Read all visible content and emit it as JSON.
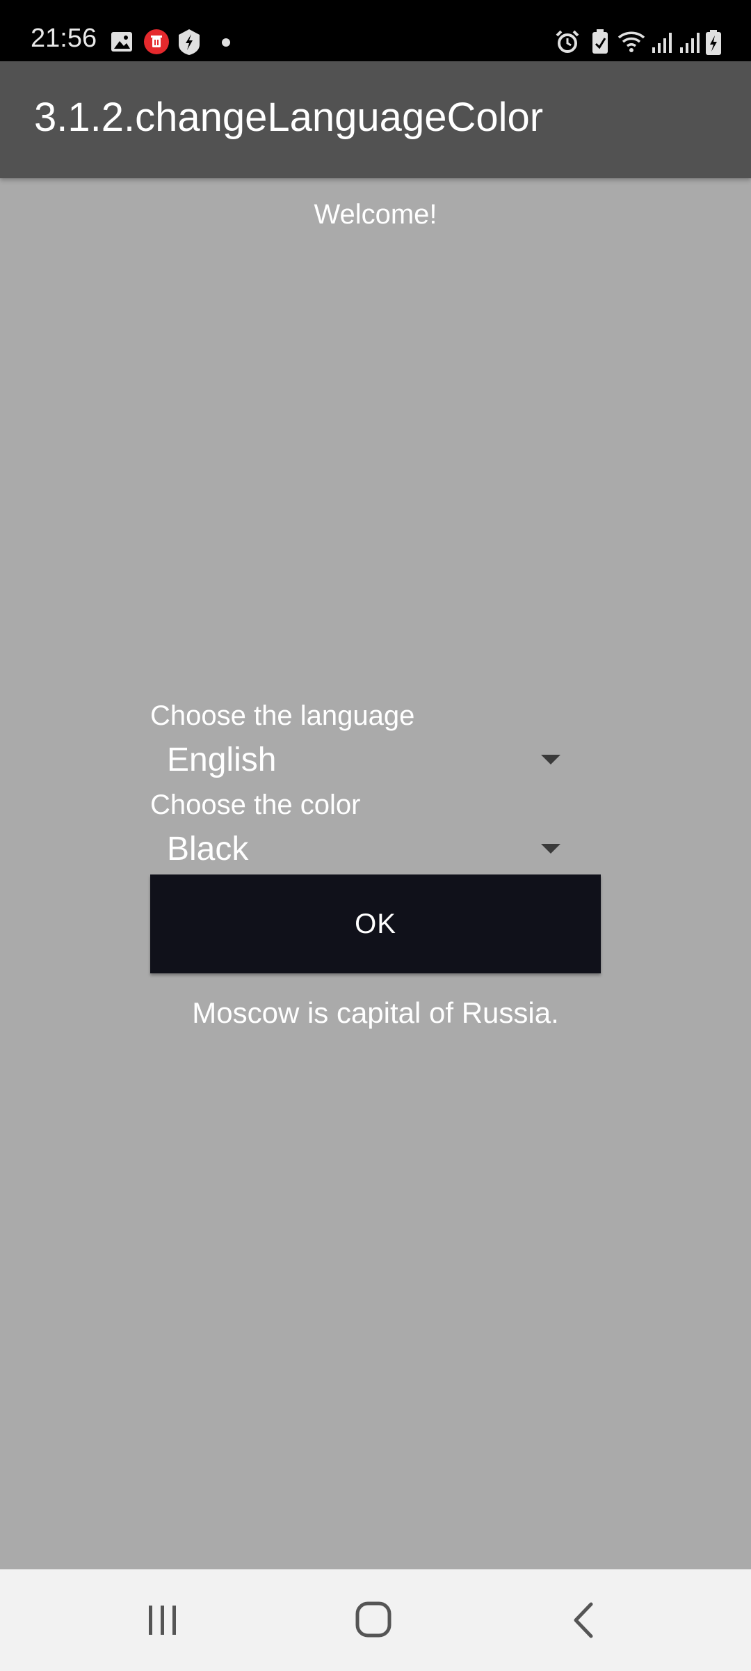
{
  "status_bar": {
    "time": "21:56",
    "left_icons": [
      "image-icon",
      "delete-notification-icon",
      "shield-icon",
      "dot-icon"
    ],
    "right_icons": [
      "alarm-icon",
      "battery-saver-icon",
      "wifi-icon",
      "signal-icon",
      "signal-icon",
      "battery-icon"
    ]
  },
  "toolbar": {
    "title": "3.1.2.changeLanguageColor"
  },
  "main": {
    "welcome": "Welcome!",
    "language_label": "Choose the language",
    "language_value": "English",
    "color_label": "Choose the color",
    "color_value": "Black",
    "ok_label": "OK",
    "result_text": "Moscow is capital of Russia."
  },
  "nav_bar": {
    "buttons": [
      "recent-apps-icon",
      "home-icon",
      "back-icon"
    ]
  },
  "colors": {
    "status_bar_bg": "#000000",
    "toolbar_bg": "#525252",
    "content_bg": "#aaaaaa",
    "button_bg": "#10111a",
    "nav_bar_bg": "#f2f2f2"
  }
}
